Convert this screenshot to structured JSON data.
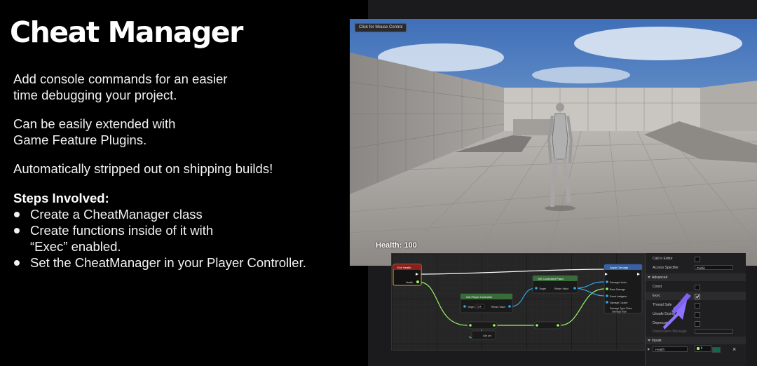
{
  "slide": {
    "title": "Cheat Manager",
    "paragraphs": [
      [
        "Add console commands for an easier",
        "time debugging your project."
      ],
      [
        "Can be easily extended with",
        "Game Feature Plugins."
      ],
      [
        "Automatically stripped out on shipping builds!"
      ]
    ],
    "steps_heading": "Steps Involved:",
    "steps": [
      [
        "Create a CheatManager class"
      ],
      [
        "Create functions inside of it with",
        "“Exec” enabled."
      ],
      [
        "Set the CheatManager in your Player Controller."
      ]
    ]
  },
  "viewport": {
    "mouse_control_label": "Click for Mouse Control",
    "health_text": "Health: 100"
  },
  "blueprint": {
    "nodes": {
      "event": {
        "title": "Exit Health",
        "pin": "Health"
      },
      "get_controller": {
        "title": "Get Player Controller",
        "pin_target": "Target",
        "pin_value": "Return Value",
        "pin_index": "self"
      },
      "get_pawn": {
        "title": "Get Controlled Pawn",
        "pin_target": "Target",
        "pin_value": "Return Value"
      },
      "apply_damage": {
        "title": "Apply Damage",
        "pins": [
          "Damaged Actor",
          "Base Damage",
          "Event Instigator",
          "Damage Causer",
          "Damage Type Class"
        ],
        "damage_type_value": "DamageType"
      },
      "add_pin": {
        "label": "Add pin"
      }
    },
    "colors": {
      "exec": "#ffffff",
      "float": "#9cf46a",
      "object": "#33a7f0",
      "teal": "#28c9a8"
    }
  },
  "details": {
    "call_in_editor": "Call In Editor",
    "access_specifier": "Access Specifier",
    "access_value": "Public",
    "advanced": "Advanced",
    "const": "Const",
    "exec": "Exec",
    "thread_safe": "Thread Safe",
    "unsafe_during": "Unsafe During",
    "deprecated": "Deprecated",
    "deprecation_message": "Deprecation Message",
    "inputs": "Inputs",
    "input_name": "Health",
    "input_type": "fl"
  }
}
